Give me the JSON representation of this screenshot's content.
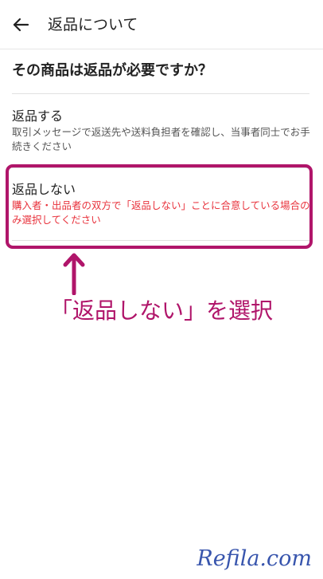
{
  "header": {
    "back_icon": "arrow-left-icon",
    "title": "返品について"
  },
  "question": "その商品は返品が必要ですか？",
  "options": [
    {
      "title": "返品する",
      "description": "取引メッセージで返送先や送料負担者を確認し、当事者同士でお手続きください"
    },
    {
      "title": "返品しない",
      "description": "購入者・出品者の双方で「返品しない」ことに合意している場合のみ選択してください",
      "description_color": "#e8323c"
    }
  ],
  "annotation": {
    "text": "「返品しない」を選択",
    "color": "#b0156a",
    "arrow_icon": "arrow-up-icon"
  },
  "watermark": "Refila.com"
}
